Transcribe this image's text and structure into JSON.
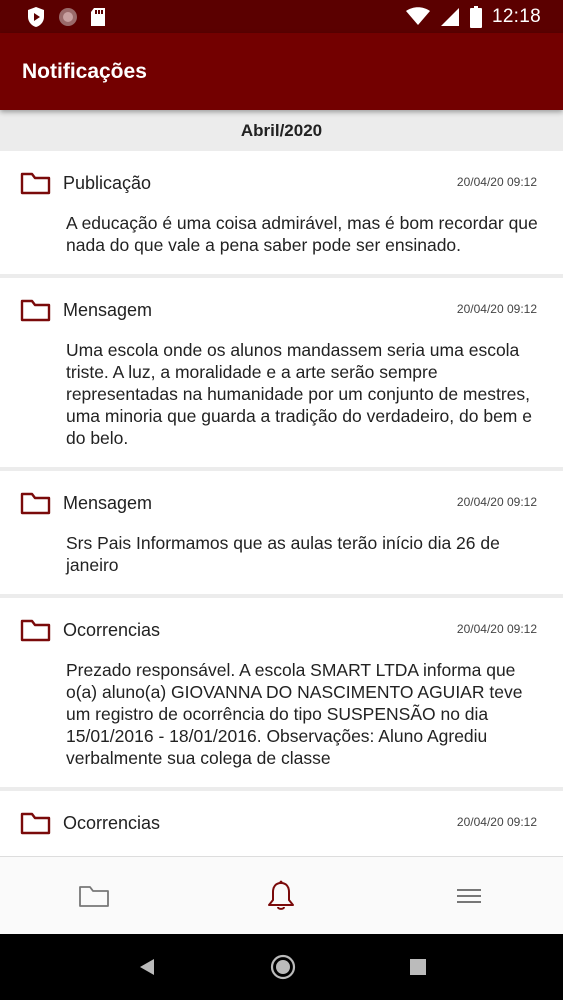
{
  "status_bar": {
    "time": "12:18",
    "icons": [
      "shield-play-icon",
      "record-icon",
      "sd-card-icon",
      "wifi-icon",
      "signal-icon",
      "battery-icon"
    ]
  },
  "app_bar": {
    "title": "Notificações"
  },
  "section": {
    "label": "Abril/2020"
  },
  "notifications": [
    {
      "title": "Publicação",
      "time": "20/04/20 09:12",
      "body": "A educação é uma coisa admirável, mas é bom recordar que nada do que vale a pena saber pode ser ensinado."
    },
    {
      "title": "Mensagem",
      "time": "20/04/20 09:12",
      "body": "Uma escola onde os alunos mandassem seria uma escola triste. A luz, a moralidade e a arte serão sempre representadas na humanidade por um conjunto de mestres, uma minoria que guarda a tradição do verdadeiro, do bem e do belo."
    },
    {
      "title": "Mensagem",
      "time": "20/04/20 09:12",
      "body": "Srs Pais Informamos que as aulas terão início dia 26 de janeiro"
    },
    {
      "title": "Ocorrencias",
      "time": "20/04/20 09:12",
      "body": "Prezado responsável. A escola SMART LTDA informa que o(a) aluno(a) GIOVANNA DO NASCIMENTO AGUIAR teve um registro de ocorrência do tipo SUSPENSÃO no dia 15/01/2016 - 18/01/2016. Observações: Aluno Agrediu verbalmente sua colega de classe"
    },
    {
      "title": "Ocorrencias",
      "time": "20/04/20 09:12",
      "body": ""
    }
  ],
  "bottom_nav": {
    "items": [
      "folder-icon",
      "bell-icon",
      "menu-icon"
    ],
    "active": "bell-icon"
  },
  "colors": {
    "status_bar": "#5b0000",
    "app_bar": "#730000",
    "accent": "#7a0a0a",
    "inactive_icon": "#777777"
  }
}
